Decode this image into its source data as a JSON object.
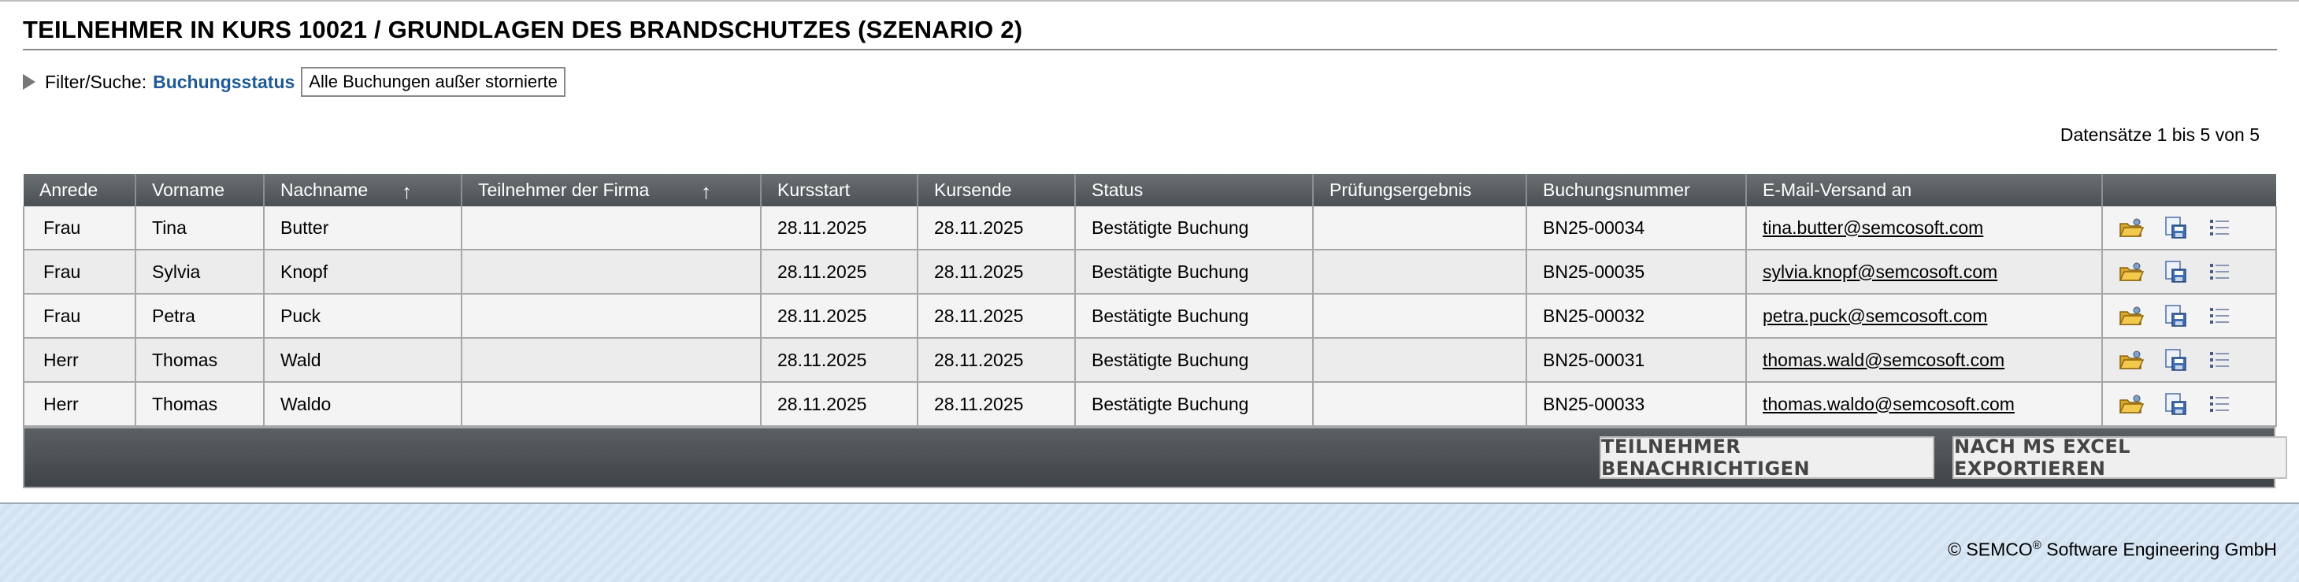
{
  "page": {
    "title": "TEILNEHMER IN KURS 10021 / GRUNDLAGEN DES BRANDSCHUTZES (SZENARIO 2)",
    "filter_label": "Filter/Suche:",
    "filter_field": "Buchungsstatus",
    "filter_value": "Alle Buchungen außer stornierte",
    "records_info": "Datensätze 1 bis 5 von 5"
  },
  "table": {
    "columns": [
      "Anrede",
      "Vorname",
      "Nachname",
      "Teilnehmer der Firma",
      "Kursstart",
      "Kursende",
      "Status",
      "Prüfungsergebnis",
      "Buchungsnummer",
      "E-Mail-Versand an",
      ""
    ],
    "sort_arrow": "↑",
    "rows": [
      {
        "anrede": "Frau",
        "vorname": "Tina",
        "nachname": "Butter",
        "firma": "",
        "start": "28.11.2025",
        "ende": "28.11.2025",
        "status": "Bestätigte Buchung",
        "pruefung": "",
        "buchung": "BN25-00034",
        "email": "tina.butter@semcosoft.com"
      },
      {
        "anrede": "Frau",
        "vorname": "Sylvia",
        "nachname": "Knopf",
        "firma": "",
        "start": "28.11.2025",
        "ende": "28.11.2025",
        "status": "Bestätigte Buchung",
        "pruefung": "",
        "buchung": "BN25-00035",
        "email": "sylvia.knopf@semcosoft.com"
      },
      {
        "anrede": "Frau",
        "vorname": "Petra",
        "nachname": "Puck",
        "firma": "",
        "start": "28.11.2025",
        "ende": "28.11.2025",
        "status": "Bestätigte Buchung",
        "pruefung": "",
        "buchung": "BN25-00032",
        "email": "petra.puck@semcosoft.com"
      },
      {
        "anrede": "Herr",
        "vorname": "Thomas",
        "nachname": "Wald",
        "firma": "",
        "start": "28.11.2025",
        "ende": "28.11.2025",
        "status": "Bestätigte Buchung",
        "pruefung": "",
        "buchung": "BN25-00031",
        "email": "thomas.wald@semcosoft.com"
      },
      {
        "anrede": "Herr",
        "vorname": "Thomas",
        "nachname": "Waldo",
        "firma": "",
        "start": "28.11.2025",
        "ende": "28.11.2025",
        "status": "Bestätigte Buchung",
        "pruefung": "",
        "buchung": "BN25-00033",
        "email": "thomas.waldo@semcosoft.com"
      }
    ],
    "row_actions": [
      "open-folder-icon",
      "save-document-icon",
      "details-list-icon"
    ]
  },
  "footer": {
    "notify_button": "TEILNEHMER BENACHRICHTIGEN",
    "export_button": "NACH MS EXCEL EXPORTIEREN",
    "copyright_prefix": "© SEMCO",
    "copyright_reg": "®",
    "copyright_suffix": " Software Engineering GmbH"
  },
  "colors": {
    "header_bg": "#55595c",
    "accent_link": "#1f5a96",
    "band_bg": "#dbe8f5"
  }
}
